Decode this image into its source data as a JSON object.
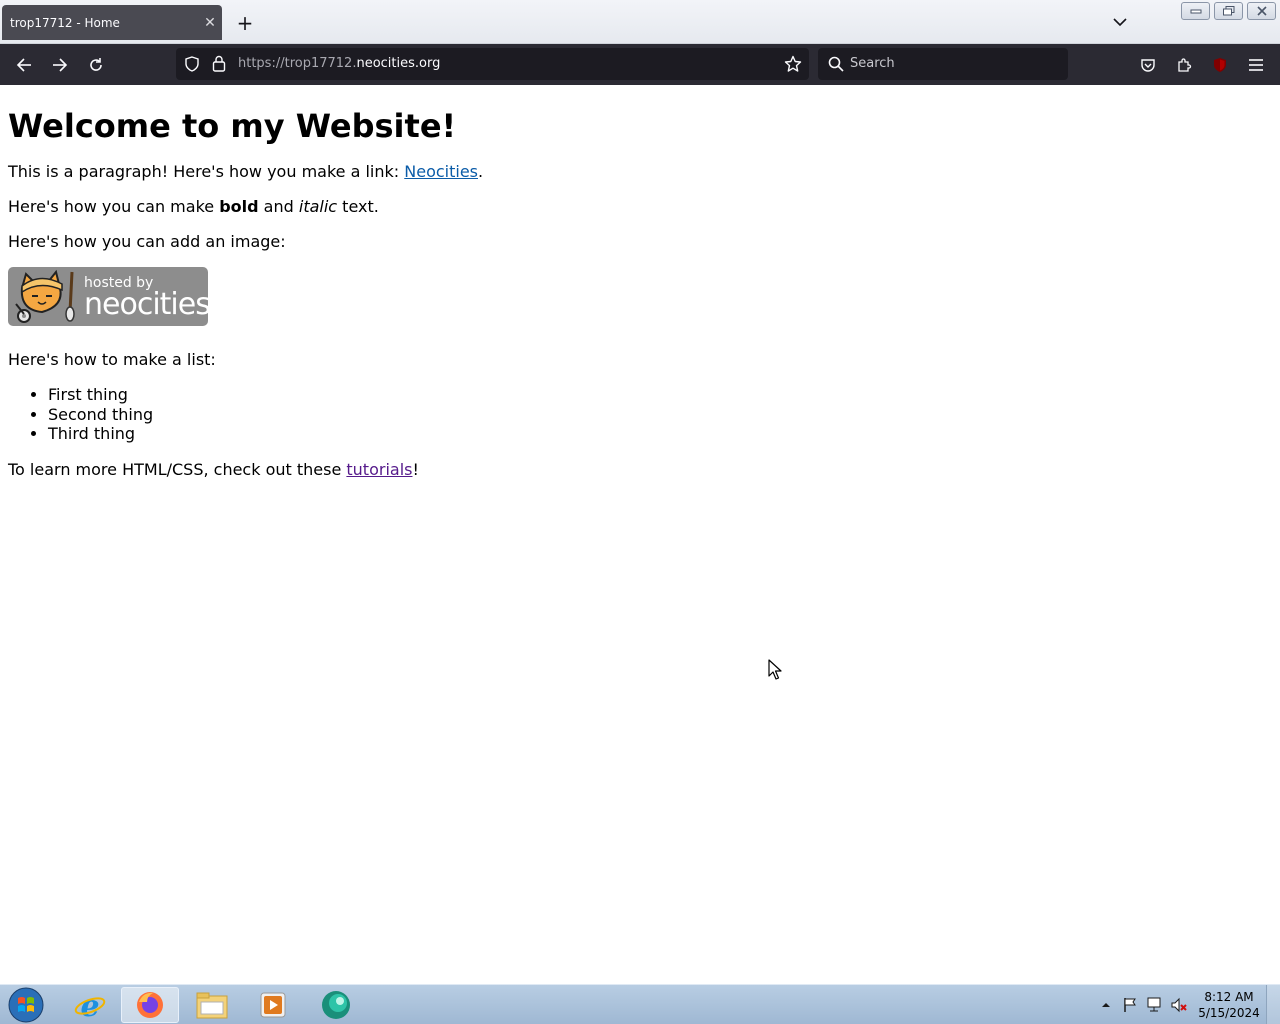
{
  "browser": {
    "tab": {
      "title": "trop17712 - Home"
    },
    "url": {
      "scheme": "https://",
      "subdomain": "trop17712.",
      "domain": "neocities.org"
    },
    "search": {
      "placeholder": "Search"
    }
  },
  "page": {
    "heading": "Welcome to my Website!",
    "p1": {
      "before": "This is a paragraph! Here's how you make a link: ",
      "link": "Neocities",
      "after": "."
    },
    "p2": {
      "before": "Here's how you can make ",
      "bold": "bold",
      "middle": " and ",
      "italic": "italic",
      "after": " text."
    },
    "p3": "Here's how you can add an image:",
    "badge": {
      "hosted": "hosted by",
      "brand": "neocities"
    },
    "p4": "Here's how to make a list:",
    "list": [
      "First thing",
      "Second thing",
      "Third thing"
    ],
    "p5": {
      "before": "To learn more HTML/CSS, check out these ",
      "link": "tutorials",
      "after": "!"
    }
  },
  "taskbar": {
    "clock": {
      "time": "8:12 AM",
      "date": "5/15/2024"
    }
  }
}
